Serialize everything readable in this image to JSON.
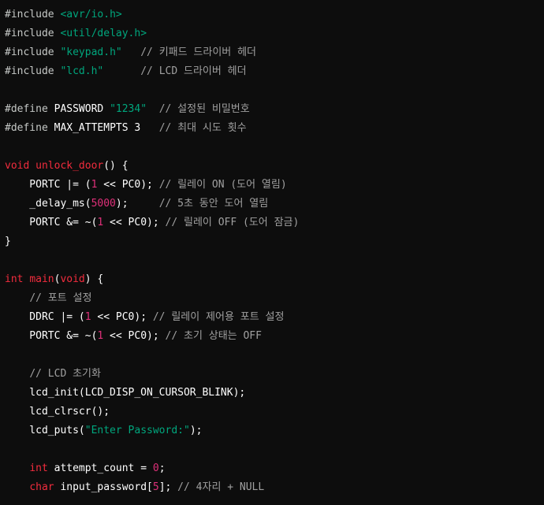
{
  "colors": {
    "background": "#0d0d0d",
    "directive": "#c5c8c6",
    "string": "#00a67d",
    "comment": "#a0a0a0",
    "keyword": "#f22c3d",
    "number": "#df3079",
    "plain": "#ffffff"
  },
  "lines": [
    [
      {
        "t": "#include",
        "k": "directive"
      },
      {
        "t": " ",
        "k": "plain"
      },
      {
        "t": "<avr/io.h>",
        "k": "string"
      }
    ],
    [
      {
        "t": "#include",
        "k": "directive"
      },
      {
        "t": " ",
        "k": "plain"
      },
      {
        "t": "<util/delay.h>",
        "k": "string"
      }
    ],
    [
      {
        "t": "#include",
        "k": "directive"
      },
      {
        "t": " ",
        "k": "plain"
      },
      {
        "t": "\"keypad.h\"",
        "k": "string"
      },
      {
        "t": "   ",
        "k": "plain"
      },
      {
        "t": "// 키패드 드라이버 헤더",
        "k": "comment"
      }
    ],
    [
      {
        "t": "#include",
        "k": "directive"
      },
      {
        "t": " ",
        "k": "plain"
      },
      {
        "t": "\"lcd.h\"",
        "k": "string"
      },
      {
        "t": "      ",
        "k": "plain"
      },
      {
        "t": "// LCD 드라이버 헤더",
        "k": "comment"
      }
    ],
    [],
    [
      {
        "t": "#define",
        "k": "directive"
      },
      {
        "t": " PASSWORD ",
        "k": "plain"
      },
      {
        "t": "\"1234\"",
        "k": "string"
      },
      {
        "t": "  ",
        "k": "plain"
      },
      {
        "t": "// 설정된 비밀번호",
        "k": "comment"
      }
    ],
    [
      {
        "t": "#define",
        "k": "directive"
      },
      {
        "t": " MAX_ATTEMPTS 3   ",
        "k": "plain"
      },
      {
        "t": "// 최대 시도 횟수",
        "k": "comment"
      }
    ],
    [],
    [
      {
        "t": "void",
        "k": "keyword"
      },
      {
        "t": " ",
        "k": "plain"
      },
      {
        "t": "unlock_door",
        "k": "keyword"
      },
      {
        "t": "() {",
        "k": "plain"
      }
    ],
    [
      {
        "t": "    PORTC |= (",
        "k": "plain"
      },
      {
        "t": "1",
        "k": "number"
      },
      {
        "t": " << PC0); ",
        "k": "plain"
      },
      {
        "t": "// 릴레이 ON (도어 열림)",
        "k": "comment"
      }
    ],
    [
      {
        "t": "    _delay_ms(",
        "k": "plain"
      },
      {
        "t": "5000",
        "k": "number"
      },
      {
        "t": ");     ",
        "k": "plain"
      },
      {
        "t": "// 5초 동안 도어 열림",
        "k": "comment"
      }
    ],
    [
      {
        "t": "    PORTC &= ~(",
        "k": "plain"
      },
      {
        "t": "1",
        "k": "number"
      },
      {
        "t": " << PC0); ",
        "k": "plain"
      },
      {
        "t": "// 릴레이 OFF (도어 잠금)",
        "k": "comment"
      }
    ],
    [
      {
        "t": "}",
        "k": "plain"
      }
    ],
    [],
    [
      {
        "t": "int",
        "k": "keyword"
      },
      {
        "t": " ",
        "k": "plain"
      },
      {
        "t": "main",
        "k": "keyword"
      },
      {
        "t": "(",
        "k": "plain"
      },
      {
        "t": "void",
        "k": "keyword"
      },
      {
        "t": ") {",
        "k": "plain"
      }
    ],
    [
      {
        "t": "    ",
        "k": "plain"
      },
      {
        "t": "// 포트 설정",
        "k": "comment"
      }
    ],
    [
      {
        "t": "    DDRC |= (",
        "k": "plain"
      },
      {
        "t": "1",
        "k": "number"
      },
      {
        "t": " << PC0); ",
        "k": "plain"
      },
      {
        "t": "// 릴레이 제어용 포트 설정",
        "k": "comment"
      }
    ],
    [
      {
        "t": "    PORTC &= ~(",
        "k": "plain"
      },
      {
        "t": "1",
        "k": "number"
      },
      {
        "t": " << PC0); ",
        "k": "plain"
      },
      {
        "t": "// 초기 상태는 OFF",
        "k": "comment"
      }
    ],
    [],
    [
      {
        "t": "    ",
        "k": "plain"
      },
      {
        "t": "// LCD 초기화",
        "k": "comment"
      }
    ],
    [
      {
        "t": "    lcd_init(LCD_DISP_ON_CURSOR_BLINK);",
        "k": "plain"
      }
    ],
    [
      {
        "t": "    lcd_clrscr();",
        "k": "plain"
      }
    ],
    [
      {
        "t": "    lcd_puts(",
        "k": "plain"
      },
      {
        "t": "\"Enter Password:\"",
        "k": "string"
      },
      {
        "t": ");",
        "k": "plain"
      }
    ],
    [],
    [
      {
        "t": "    ",
        "k": "plain"
      },
      {
        "t": "int",
        "k": "keyword"
      },
      {
        "t": " attempt_count = ",
        "k": "plain"
      },
      {
        "t": "0",
        "k": "number"
      },
      {
        "t": ";",
        "k": "plain"
      }
    ],
    [
      {
        "t": "    ",
        "k": "plain"
      },
      {
        "t": "char",
        "k": "keyword"
      },
      {
        "t": " input_password[",
        "k": "plain"
      },
      {
        "t": "5",
        "k": "number"
      },
      {
        "t": "]; ",
        "k": "plain"
      },
      {
        "t": "// 4자리 + NULL",
        "k": "comment"
      }
    ]
  ]
}
